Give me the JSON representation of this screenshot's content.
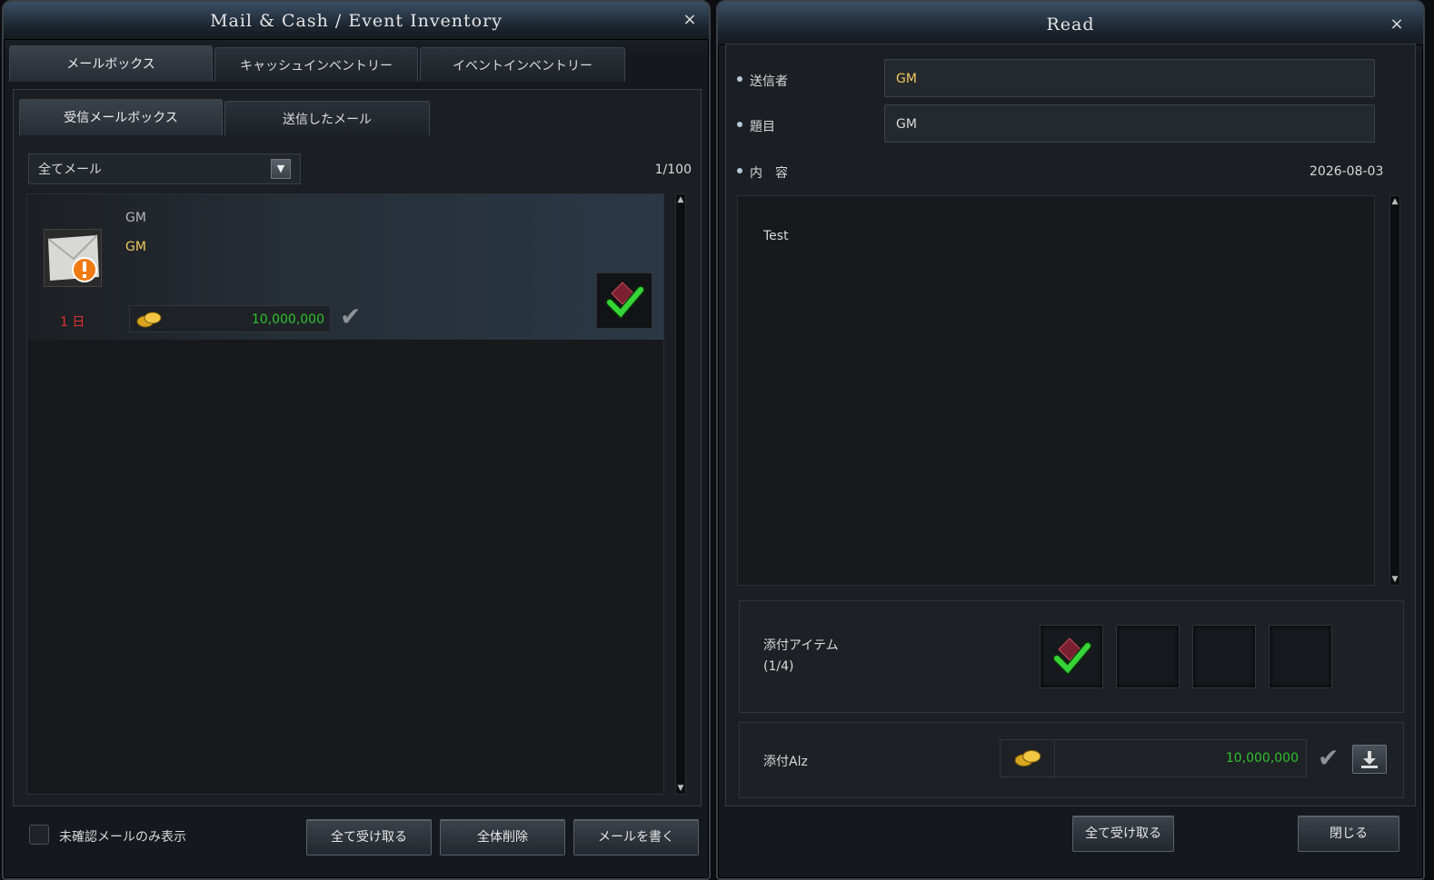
{
  "left_window": {
    "title": "Mail & Cash / Event Inventory",
    "close": "×",
    "tabs": [
      "メールボックス",
      "キャッシュインベントリー",
      "イベントインベントリー"
    ],
    "subtabs": [
      "受信メールボックス",
      "送信したメール"
    ],
    "filter_value": "全てメール",
    "page_count": "1/100",
    "mail_item": {
      "sender": "GM",
      "subject": "GM",
      "days_left": "1 日",
      "alz_amount": "10,000,000"
    },
    "unread_only_label": "未確認メールのみ表示",
    "buttons": {
      "receive_all": "全て受け取る",
      "delete_all": "全体削除",
      "write": "メールを書く"
    }
  },
  "right_window": {
    "title": "Read",
    "close": "×",
    "sender_label": "送信者",
    "sender_value": "GM",
    "subject_label": "題目",
    "subject_value": "GM",
    "content_label": "内　容",
    "date": "2026-08-03",
    "body": "Test",
    "attached_items_label": "添付アイテム",
    "attached_items_count": "(1/4)",
    "attached_alz_label": "添付Alz",
    "attached_alz_amount": "10,000,000",
    "buttons": {
      "receive_all": "全て受け取る",
      "close": "閉じる"
    }
  },
  "colors": {
    "gold_text": "#f1c85e",
    "green_amount": "#2fc12f",
    "red_days": "#e03030",
    "check_green": "#37d437"
  }
}
